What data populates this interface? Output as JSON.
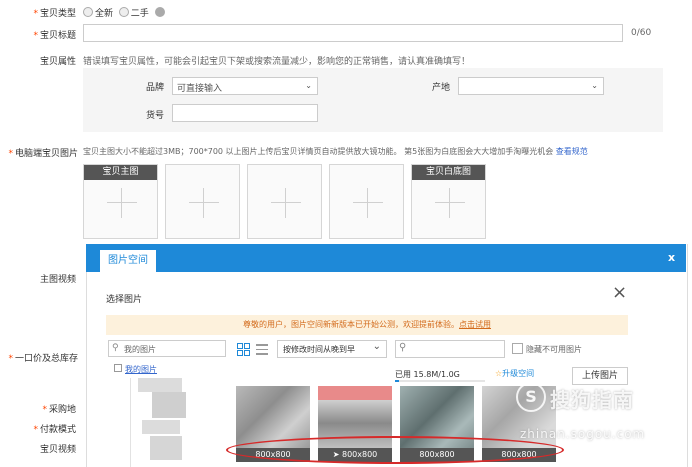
{
  "form": {
    "type_label": "宝贝类型",
    "type_options": [
      "全新",
      "二手"
    ],
    "title_label": "宝贝标题",
    "title_counter": "0/60",
    "attr_label": "宝贝属性",
    "attr_hint": "错误填写宝贝属性，可能会引起宝贝下架或搜索流量减少，影响您的正常销售，请认真准确填写！",
    "brand_label": "品牌",
    "brand_value": "可直接输入",
    "origin_label": "产地",
    "sku_label": "货号",
    "pc_images_label": "电脑端宝贝图片",
    "pc_images_hint": "宝贝主图大小不能超过3MB；700*700 以上图片上传后宝贝详情页自动提供放大镜功能。 第5张图为白底图会大大增加手淘曝光机会",
    "pc_images_link": "查看规范",
    "main_img_tag": "宝贝主图",
    "white_img_tag": "宝贝白底图",
    "video_label": "主图视频",
    "price_label": "一口价及总库存",
    "purchase_label": "采购地",
    "pay_label": "付款模式",
    "baby_video_label": "宝贝视频"
  },
  "dialog": {
    "tab": "图片空间",
    "close": "x",
    "subtitle": "选择图片",
    "notice": "尊敬的用户，图片空间新新版本已开始公测，欢迎提前体验。",
    "notice_link": "点击试用",
    "search_placeholder": "我的图片",
    "folder": "我的图片",
    "sort": "按修改时间从晚到早",
    "hide_label": "隐藏不可用图片",
    "usage": "已用 15.8M/1.0G",
    "upgrade": "升级空间",
    "upload": "上传图片",
    "captions": [
      "800x800",
      "800x800",
      "800x800",
      "800x800"
    ]
  },
  "watermark": {
    "brand": "搜狗指南",
    "url": "zhinan.sogou.com"
  },
  "colors": {
    "accent": "#1e89d8",
    "required": "#ff4400",
    "annotation": "#d62a2a"
  }
}
